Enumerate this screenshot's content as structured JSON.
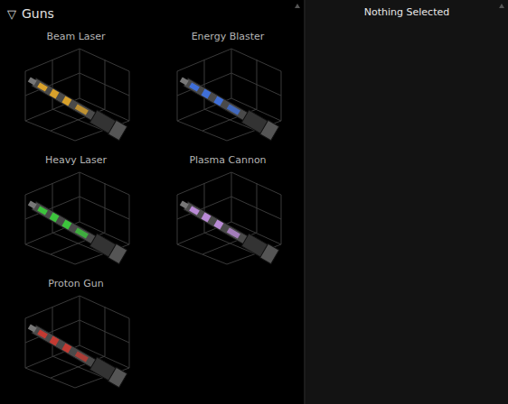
{
  "category": {
    "icon": "▽",
    "label": "Guns",
    "expanded": true
  },
  "items": [
    {
      "name": "Beam Laser",
      "color": "#d9a12b",
      "selected": false
    },
    {
      "name": "Energy Blaster",
      "color": "#3f6fd8",
      "selected": false
    },
    {
      "name": "Heavy Laser",
      "color": "#3cc43c",
      "selected": false
    },
    {
      "name": "Plasma Cannon",
      "color": "#b98ad6",
      "selected": false
    },
    {
      "name": "Proton Gun",
      "color": "#c23a32",
      "selected": false
    }
  ],
  "details": {
    "title": "Nothing Selected"
  }
}
